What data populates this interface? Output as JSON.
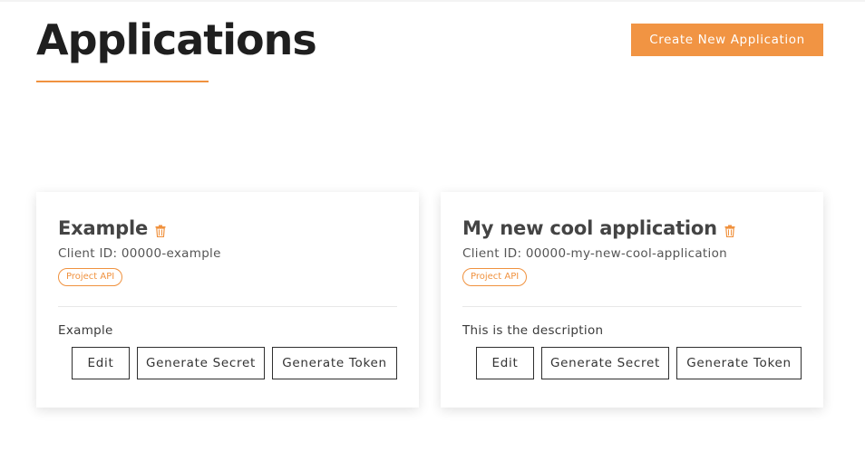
{
  "header": {
    "title": "Applications",
    "create_button_label": "Create New Application"
  },
  "colors": {
    "accent": "#f19443",
    "text": "#1f1f1f"
  },
  "applications": [
    {
      "name": "Example",
      "client_id_text": "Client ID: 00000-example",
      "badge": "Project API",
      "description": "Example",
      "actions": {
        "edit": "Edit",
        "generate_secret": "Generate Secret",
        "generate_token": "Generate Token"
      }
    },
    {
      "name": "My new cool application",
      "client_id_text": "Client ID: 00000-my-new-cool-application",
      "badge": "Project API",
      "description": "This is the description",
      "actions": {
        "edit": "Edit",
        "generate_secret": "Generate Secret",
        "generate_token": "Generate Token"
      }
    }
  ],
  "icons": {
    "delete": "trash-icon"
  }
}
